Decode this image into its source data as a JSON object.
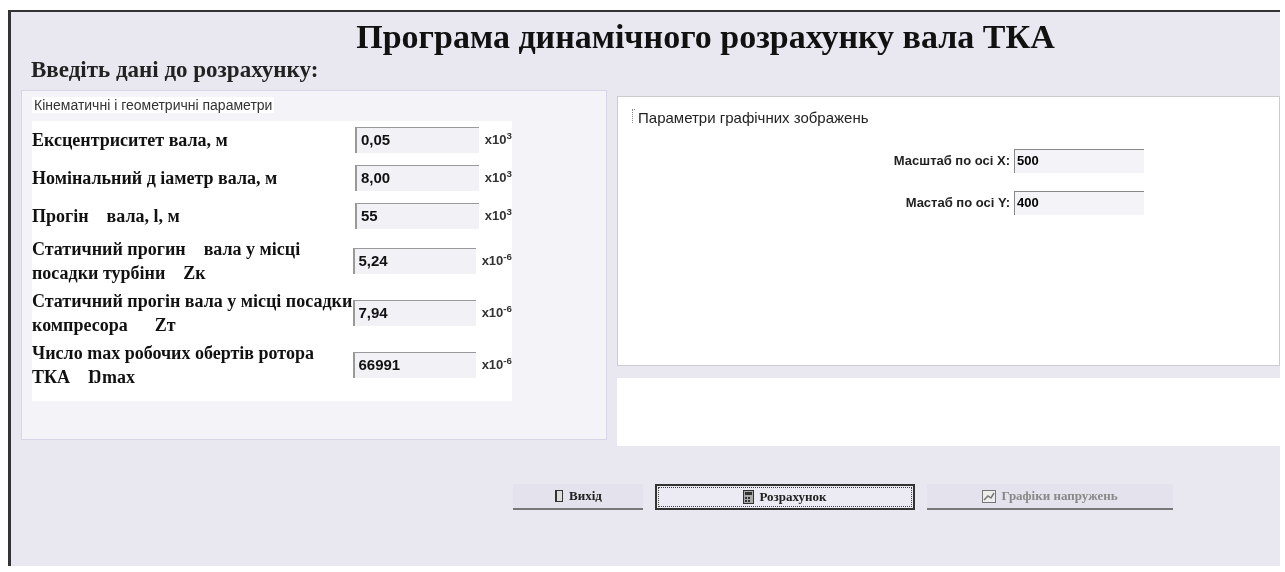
{
  "title": "Програма динамічного розрахунку вала  ТКА",
  "subtitle": "Введіть дані до розрахунку:",
  "kinematic_group": {
    "caption": "Кінематичні і геометричні параметри",
    "fields": [
      {
        "label": "Ексцентриситет вала, м",
        "value": "0,05",
        "unit": "x10$^{3}$"
      },
      {
        "label": "Номінальний д іаметр вала, м",
        "value": "8,00",
        "unit": "x10$^{3}$"
      },
      {
        "label": "Прогін    вала, l, м",
        "value": "55",
        "unit": "x10$^{3}$"
      },
      {
        "label": "Статичний прогин    вала у місці посадки турбіни    Zк",
        "value": "5,24",
        "unit": "x10$^{-6}$"
      },
      {
        "label": "Статичний прогін вала у місці посадки компресора      Zт",
        "value": "7,94",
        "unit": "x10$^{-6}$"
      },
      {
        "label": "Число max робочих обертів ротора ТКА    Ŋmax",
        "value": "66991",
        "unit": "x10$^{-6}$"
      }
    ]
  },
  "graphics_group": {
    "caption": "Параметри графічних зображень",
    "fields": [
      {
        "label": "Масштаб по осі X:",
        "value": "500"
      },
      {
        "label": "Мастаб по осі Y:",
        "value": "400"
      }
    ]
  },
  "buttons": [
    {
      "kind": "exit",
      "label": "Вихід",
      "focused": false,
      "disabled": false
    },
    {
      "kind": "calc",
      "label": "Розрахунок",
      "focused": true,
      "disabled": false
    },
    {
      "kind": "chart",
      "label": "Графіки напружень",
      "focused": false,
      "disabled": true
    }
  ]
}
